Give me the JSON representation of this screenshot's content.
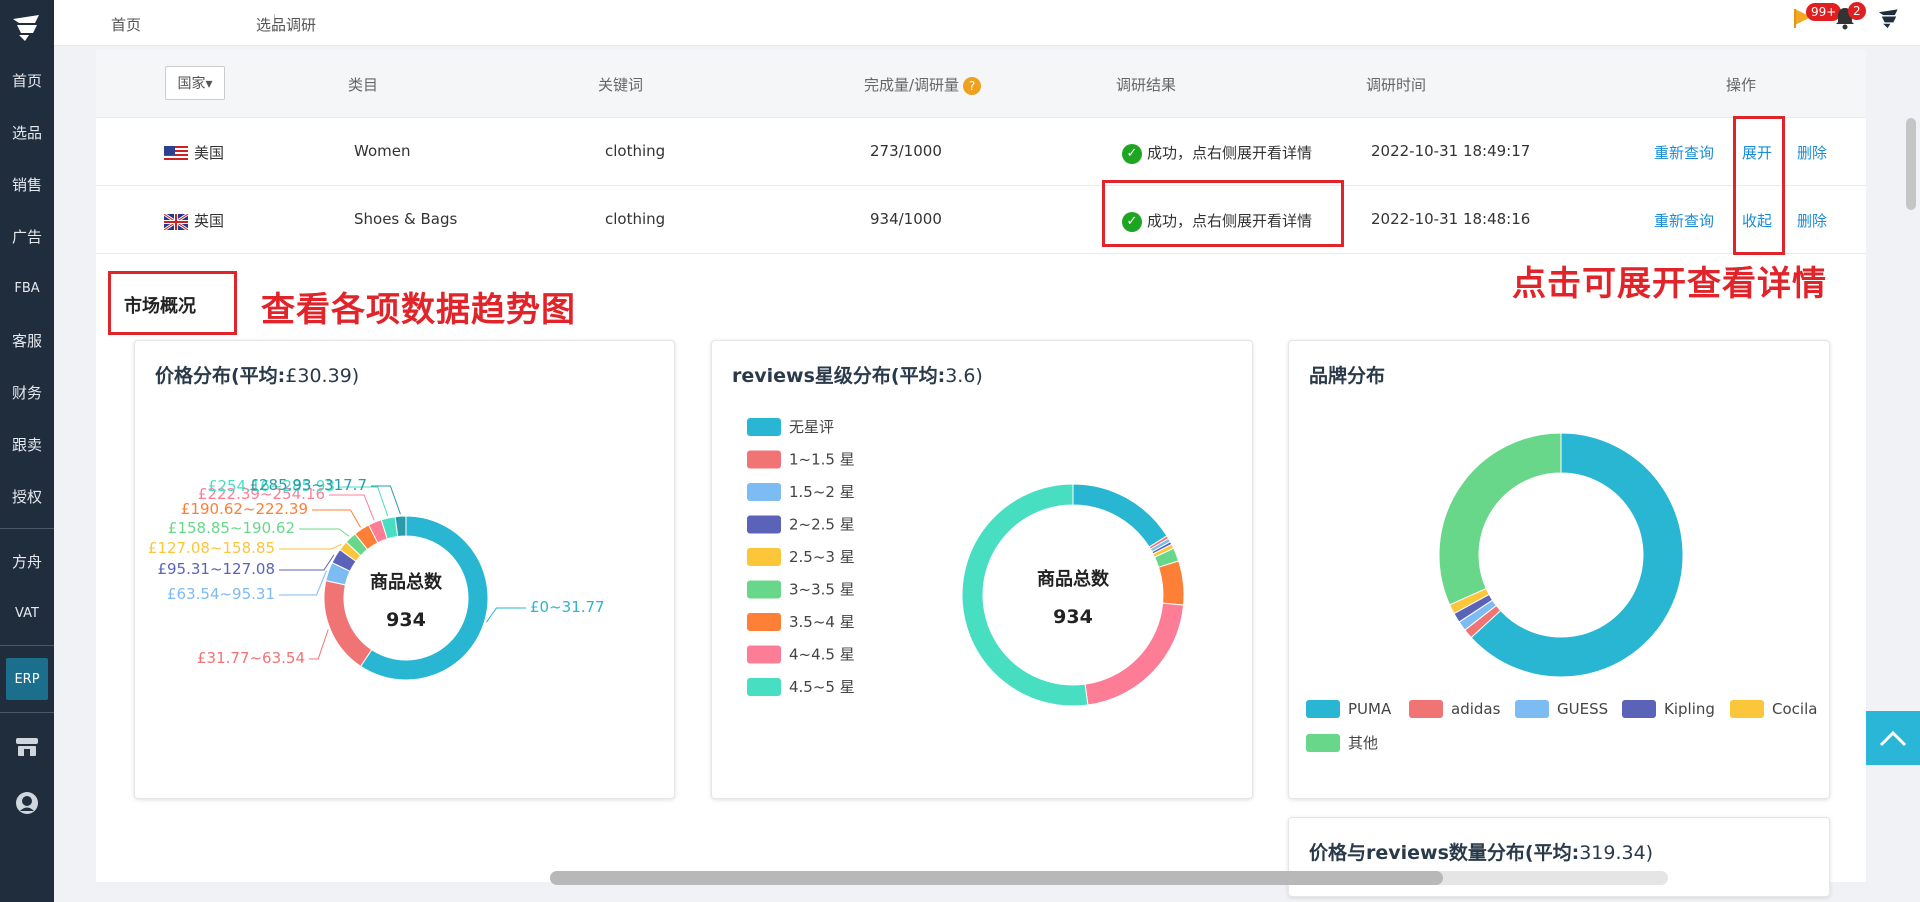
{
  "sidebar": {
    "items": [
      "首页",
      "选品",
      "销售",
      "广告",
      "FBA",
      "客服",
      "财务",
      "跟卖",
      "授权"
    ],
    "items2": [
      "方舟",
      "VAT"
    ],
    "erp": "ERP"
  },
  "topbar": {
    "breadcrumb": [
      "首页",
      "选品调研"
    ],
    "flag_badge": "99+",
    "bell_badge": "2"
  },
  "table": {
    "headers": {
      "country": "国家▾",
      "category": "类目",
      "keyword": "关键词",
      "progress": "完成量/调研量",
      "result": "调研结果",
      "time": "调研时间",
      "ops": "操作"
    },
    "rows": [
      {
        "country": "美国",
        "category": "Women",
        "keyword": "clothing",
        "progress": "273/1000",
        "result": "成功，点右侧展开看详情",
        "time": "2022-10-31 18:49:17",
        "op1": "重新查询",
        "op2": "展开",
        "op3": "删除"
      },
      {
        "country": "英国",
        "category": "Shoes & Bags",
        "keyword": "clothing",
        "progress": "934/1000",
        "result": "成功，点右侧展开看详情",
        "time": "2022-10-31 18:48:16",
        "op1": "重新查询",
        "op2": "收起",
        "op3": "删除"
      }
    ]
  },
  "annotations": {
    "right": "点击可展开查看详情",
    "left": "查看各项数据趋势图"
  },
  "section_title": "市场概况",
  "charts": {
    "price": {
      "title": "价格分布(平均:",
      "title_num": "£30.39",
      "title_end": ")",
      "center_label": "商品总数",
      "center_value": "934"
    },
    "reviews": {
      "title": "reviews星级分布(平均:",
      "title_num": "3.6",
      "title_end": ")",
      "center_label": "商品总数",
      "center_value": "934"
    },
    "brand": {
      "title": "品牌分布"
    },
    "price_reviews": {
      "title": "价格与reviews数量分布(平均:",
      "title_num": "319.34",
      "title_end": ")"
    }
  },
  "chart_data": [
    {
      "type": "pie",
      "title": "价格分布(平均:£30.39)",
      "categories": [
        "£0~31.77",
        "£31.77~63.54",
        "£63.54~95.31",
        "£95.31~127.08",
        "£127.08~158.85",
        "£158.85~190.62",
        "£190.62~222.39",
        "£222.39~254.16",
        "£254.16~285.93",
        "£285.93~317.7"
      ],
      "values": [
        560,
        180,
        35,
        28,
        18,
        22,
        30,
        25,
        26,
        20
      ],
      "colors": [
        "#29b6d2",
        "#f07474",
        "#7cbcf2",
        "#5b63b8",
        "#fcc63a",
        "#68d78a",
        "#fd8036",
        "#fd7d97",
        "#47dec2",
        "#2a9ba8"
      ]
    },
    {
      "type": "pie",
      "title": "reviews星级分布(平均:3.6)",
      "categories": [
        "无星评",
        "1~1.5 星",
        "1.5~2 星",
        "2~2.5 星",
        "2.5~3 星",
        "3~3.5 星",
        "3.5~4 星",
        "4~4.5 星",
        "4.5~5 星"
      ],
      "values": [
        150,
        4,
        5,
        4,
        6,
        18,
        60,
        200,
        487
      ],
      "colors": [
        "#29b6d2",
        "#f07474",
        "#7cbcf2",
        "#5b63b8",
        "#fcc63a",
        "#68d78a",
        "#fd8036",
        "#fd7d97",
        "#47dec2"
      ]
    },
    {
      "type": "pie",
      "title": "品牌分布",
      "categories": [
        "PUMA",
        "adidas",
        "GUESS",
        "Kipling",
        "Cocila",
        "其他"
      ],
      "values": [
        590,
        12,
        12,
        12,
        12,
        296
      ],
      "colors": [
        "#29b6d2",
        "#f07474",
        "#7cbcf2",
        "#5b63b8",
        "#fcc63a",
        "#68d78a"
      ]
    }
  ]
}
